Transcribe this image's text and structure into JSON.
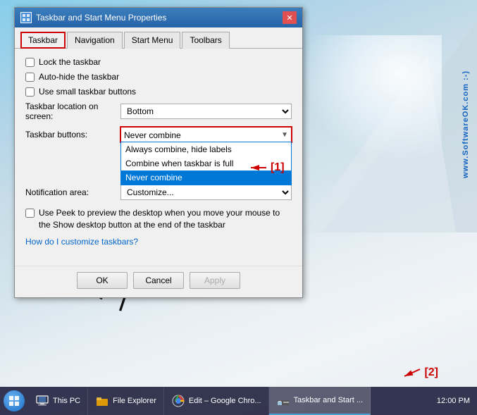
{
  "desktop": {
    "watermark": "www.SoftwareOK.com :-)"
  },
  "dialog": {
    "title": "Taskbar and Start Menu Properties",
    "tabs": [
      {
        "label": "Taskbar",
        "active": true
      },
      {
        "label": "Navigation",
        "active": false
      },
      {
        "label": "Start Menu",
        "active": false
      },
      {
        "label": "Toolbars",
        "active": false
      }
    ],
    "checkboxes": [
      {
        "label": "Lock the taskbar",
        "checked": false
      },
      {
        "label": "Auto-hide the taskbar",
        "checked": false
      },
      {
        "label": "Use small taskbar buttons",
        "checked": false
      }
    ],
    "location_label": "Taskbar location on screen:",
    "location_value": "Bottom",
    "buttons_label": "Taskbar buttons:",
    "buttons_selected": "Never combine",
    "buttons_options": [
      {
        "label": "Always combine, hide labels",
        "selected": false
      },
      {
        "label": "Combine when taskbar is full",
        "selected": false
      },
      {
        "label": "Never combine",
        "selected": true
      }
    ],
    "notification_label": "Notification area:",
    "peek_checkbox": false,
    "peek_text": "Use Peek to preview the desktop when you move your mouse to the\nShow desktop button at the end of the taskbar",
    "help_link": "How do I customize taskbars?",
    "ok_btn": "OK",
    "cancel_btn": "Cancel",
    "apply_btn": "Apply"
  },
  "annotations": {
    "label1": "[1]",
    "label2": "[2]"
  },
  "taskbar": {
    "items": [
      {
        "label": "This PC",
        "icon": "computer"
      },
      {
        "label": "File Explorer",
        "icon": "folder"
      },
      {
        "label": "Edit – Google Chro...",
        "icon": "chrome"
      },
      {
        "label": "Taskbar and Start ...",
        "icon": "settings",
        "active": true
      }
    ]
  }
}
